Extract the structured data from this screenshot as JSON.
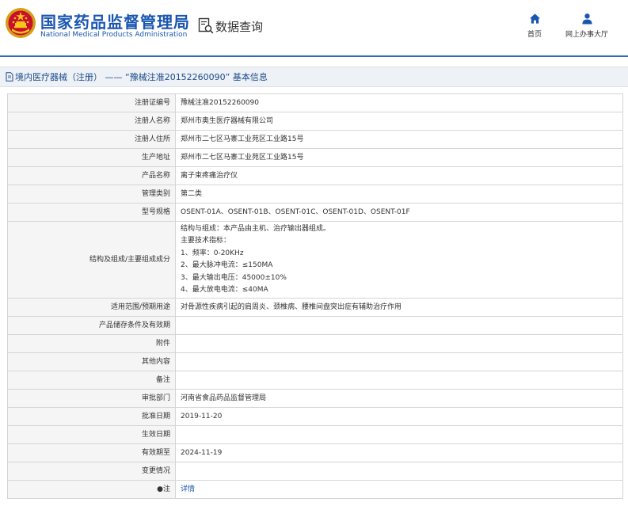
{
  "header": {
    "brand_cn": "国家药品监督管理局",
    "brand_en": "National Medical Products Administration",
    "query_title": "数据查询",
    "nav": {
      "home": "首页",
      "service": "网上办事大厅"
    },
    "accent_color": "#1a56b0"
  },
  "title_bar": {
    "text": "境内医疗器械（注册） —— “豫械注准20152260090” 基本信息"
  },
  "table": {
    "rows": [
      {
        "label": "注册证编号",
        "value": "豫械注准20152260090"
      },
      {
        "label": "注册人名称",
        "value": "郑州市奥生医疗器械有限公司"
      },
      {
        "label": "注册人住所",
        "value": "郑州市二七区马寨工业苑区工业路15号"
      },
      {
        "label": "生产地址",
        "value": "郑州市二七区马寨工业苑区工业路15号"
      },
      {
        "label": "产品名称",
        "value": "离子束疼痛治疗仪"
      },
      {
        "label": "管理类别",
        "value": "第二类"
      },
      {
        "label": "型号规格",
        "value": "OSENT-01A、OSENT-01B、OSENT-01C、OSENT-01D、OSENT-01F"
      },
      {
        "label": "结构及组成/主要组成成分",
        "lines": [
          "结构与组成：本产品由主机、治疗输出器组成。",
          "主要技术指标：",
          "1、频率：0-20KHz",
          "2、最大脉冲电流：≤150MA",
          "3、最大输出电压：45000±10%",
          "4、最大放电电流：≤40MA"
        ]
      },
      {
        "label": "适用范围/预期用途",
        "value": "对骨源性疾病引起的肩周炎、颈椎病、腰椎间盘突出症有辅助治疗作用"
      },
      {
        "label": "产品储存条件及有效期",
        "value": ""
      },
      {
        "label": "附件",
        "value": ""
      },
      {
        "label": "其他内容",
        "value": ""
      },
      {
        "label": "备注",
        "value": ""
      },
      {
        "label": "审批部门",
        "value": "河南省食品药品监督管理局"
      },
      {
        "label": "批准日期",
        "value": "2019-11-20"
      },
      {
        "label": "生效日期",
        "value": ""
      },
      {
        "label": "有效期至",
        "value": "2024-11-19"
      },
      {
        "label": "变更情况",
        "value": ""
      },
      {
        "label": "●注",
        "value": "详情"
      }
    ]
  }
}
